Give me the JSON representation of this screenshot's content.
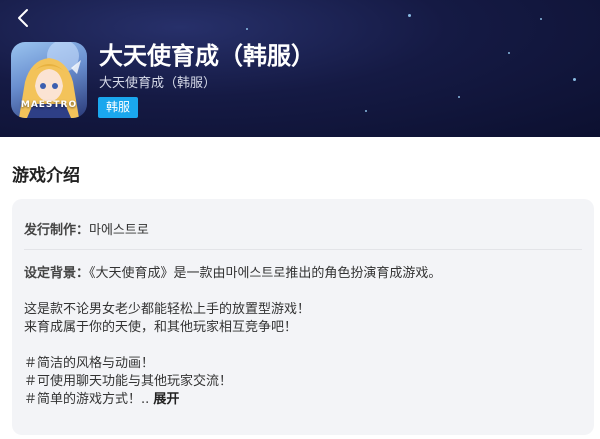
{
  "header": {
    "back_icon": "chevron-left-icon",
    "title": "大天使育成（韩服）",
    "subtitle": "大天使育成（韩服）",
    "icon_text": "MAESTRO",
    "tag": "韩服",
    "tag_color": "#1aa7ee"
  },
  "section_title": "游戏介绍",
  "details": {
    "publisher_label": "发行制作：",
    "publisher_value": "마에스트로",
    "desc_label": "设定背景：",
    "desc_line1": "《大天使育成》是一款由마에스트로推出的角色扮演育成游戏。",
    "para2_line1": "这是款不论男女老少都能轻松上手的放置型游戏！",
    "para2_line2": "来育成属于你的天使，和其他玩家相互竞争吧！",
    "feature1": "＃简洁的风格与动画！",
    "feature2": "＃可使用聊天功能与其他玩家交流！",
    "feature3": "＃简单的游戏方式！..",
    "expand_label": "展开"
  }
}
